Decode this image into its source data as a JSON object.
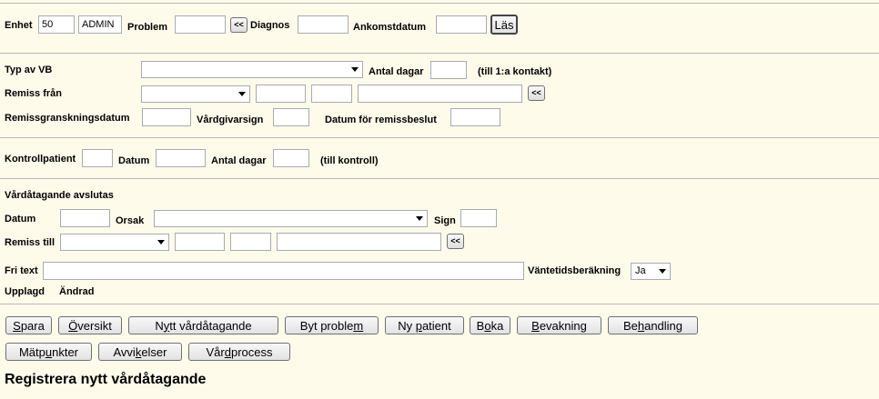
{
  "row1": {
    "enhet_label": "Enhet",
    "enhet_value": "50",
    "admin_value": "ADMIN",
    "problem_label": "Problem",
    "back_symbol": "<<",
    "diagnos_label": "Diagnos",
    "ankomst_label": "Ankomstdatum",
    "las_button": "Läs"
  },
  "section2": {
    "typ_label": "Typ av VB",
    "antal_dagar_label": "Antal dagar",
    "till_kontakt_note": "(till 1:a kontakt)",
    "remiss_fran_label": "Remiss från",
    "back_symbol": "<<",
    "remissgransk_label": "Remissgranskningsdatum",
    "vardgivarsign_label": "Vårdgivarsign",
    "datum_remissbeslut_label": "Datum för remissbeslut"
  },
  "section3": {
    "kontrollpatient_label": "Kontrollpatient",
    "datum_label": "Datum",
    "antal_dagar_label": "Antal dagar",
    "till_kontroll_note": "(till kontroll)"
  },
  "section4": {
    "heading": "Vårdåtagande avslutas",
    "datum_label": "Datum",
    "orsak_label": "Orsak",
    "sign_label": "Sign",
    "remiss_till_label": "Remiss till",
    "back_symbol": "<<",
    "fritext_label": "Fri text",
    "vantetid_label": "Väntetidsberäkning",
    "vantetid_value": "Ja",
    "upplagd_label": "Upplagd",
    "andrad_label": "Ändrad"
  },
  "buttons": {
    "spara": {
      "pre": "",
      "u": "S",
      "post": "para"
    },
    "oversikt": {
      "pre": "",
      "u": "Ö",
      "post": "versikt"
    },
    "nytt": {
      "pre": "N",
      "u": "y",
      "post": "tt vårdåtagande"
    },
    "byt": {
      "pre": "Byt proble",
      "u": "m",
      "post": ""
    },
    "nypatient": {
      "pre": "Ny ",
      "u": "p",
      "post": "atient"
    },
    "boka": {
      "pre": "B",
      "u": "o",
      "post": "ka"
    },
    "bevakning": {
      "pre": "",
      "u": "B",
      "post": "evakning"
    },
    "behandling": {
      "pre": "Be",
      "u": "h",
      "post": "andling"
    },
    "matpunkter": {
      "pre": "Mätp",
      "u": "u",
      "post": "nkter"
    },
    "avvikelser": {
      "pre": "Avvi",
      "u": "k",
      "post": "elser"
    },
    "vardprocess": {
      "pre": "Vår",
      "u": "d",
      "post": "process"
    }
  },
  "page_title": "Registrera nytt vårdåtagande"
}
